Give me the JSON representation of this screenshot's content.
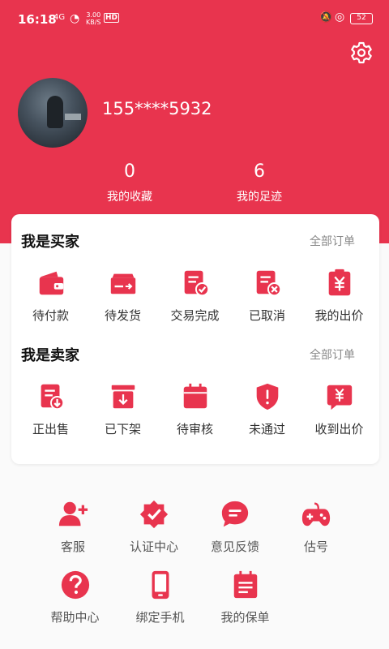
{
  "status_bar": {
    "time": "16:18",
    "signal": "4G",
    "speed_value": "3.00",
    "speed_unit": "KB/S",
    "hd": "HD",
    "battery": "52"
  },
  "profile": {
    "phone": "155****5932",
    "favorites_count": "0",
    "favorites_label": "我的收藏",
    "footprint_count": "6",
    "footprint_label": "我的足迹"
  },
  "colors": {
    "brand": "#e8344e",
    "accent_icon": "#e8344e"
  },
  "buyer": {
    "title": "我是买家",
    "all_orders": "全部订单",
    "items": [
      {
        "label": "待付款",
        "icon": "wallet-icon"
      },
      {
        "label": "待发货",
        "icon": "shipping-card-icon"
      },
      {
        "label": "交易完成",
        "icon": "document-check-icon"
      },
      {
        "label": "已取消",
        "icon": "document-cancel-icon"
      },
      {
        "label": "我的出价",
        "icon": "yuan-clipboard-icon"
      }
    ]
  },
  "seller": {
    "title": "我是卖家",
    "all_orders": "全部订单",
    "items": [
      {
        "label": "正出售",
        "icon": "document-down-icon"
      },
      {
        "label": "已下架",
        "icon": "box-down-icon"
      },
      {
        "label": "待审核",
        "icon": "calendar-icon"
      },
      {
        "label": "未通过",
        "icon": "shield-alert-icon"
      },
      {
        "label": "收到出价",
        "icon": "yuan-message-icon"
      }
    ]
  },
  "tools": {
    "items": [
      {
        "label": "客服",
        "icon": "add-user-icon"
      },
      {
        "label": "认证中心",
        "icon": "verified-badge-icon"
      },
      {
        "label": "意见反馈",
        "icon": "chat-bubble-icon"
      },
      {
        "label": "估号",
        "icon": "gamepad-icon"
      },
      {
        "label": "帮助中心",
        "icon": "help-circle-icon"
      },
      {
        "label": "绑定手机",
        "icon": "mobile-phone-icon"
      },
      {
        "label": "我的保单",
        "icon": "policy-clipboard-icon"
      }
    ]
  }
}
